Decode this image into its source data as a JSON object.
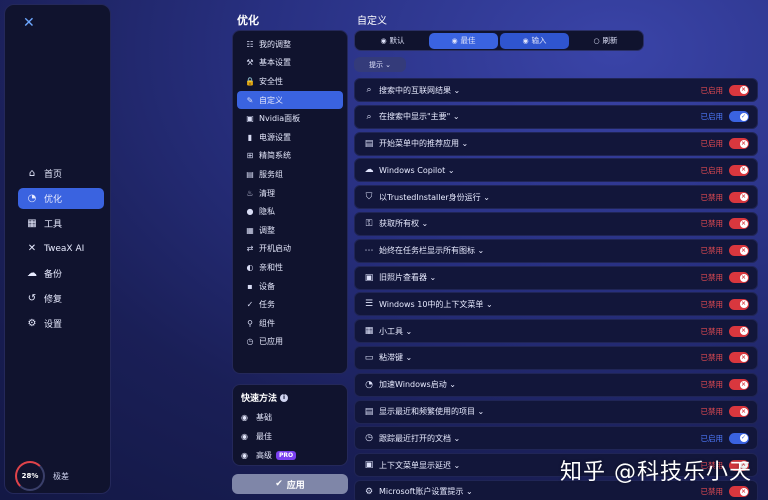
{
  "app": {
    "logo": "✕"
  },
  "sidebar": {
    "items": [
      {
        "label": "首页",
        "icon": "home-icon",
        "glyph": "⌂"
      },
      {
        "label": "优化",
        "icon": "gauge-icon",
        "glyph": "◔"
      },
      {
        "label": "工具",
        "icon": "grid-icon",
        "glyph": "▦"
      },
      {
        "label": "TweaX AI",
        "icon": "ai-icon",
        "glyph": "✕"
      },
      {
        "label": "备份",
        "icon": "cloud-icon",
        "glyph": "☁"
      },
      {
        "label": "修复",
        "icon": "history-icon",
        "glyph": "↺"
      },
      {
        "label": "设置",
        "icon": "gear-icon",
        "glyph": "⚙"
      }
    ],
    "score": "28%",
    "score_label": "极差"
  },
  "middle": {
    "title": "优化",
    "categories": [
      {
        "label": "我的调整",
        "glyph": "☷"
      },
      {
        "label": "基本设置",
        "glyph": "⚒"
      },
      {
        "label": "安全性",
        "glyph": "🔒"
      },
      {
        "label": "自定义",
        "glyph": "✎"
      },
      {
        "label": "Nvidia面板",
        "glyph": "▣"
      },
      {
        "label": "电源设置",
        "glyph": "▮"
      },
      {
        "label": "精简系统",
        "glyph": "⊞"
      },
      {
        "label": "服务组",
        "glyph": "▤"
      },
      {
        "label": "清理",
        "glyph": "♨"
      },
      {
        "label": "隐私",
        "glyph": "●"
      },
      {
        "label": "调整",
        "glyph": "▦"
      },
      {
        "label": "开机启动",
        "glyph": "⇄"
      },
      {
        "label": "亲和性",
        "glyph": "◐"
      },
      {
        "label": "设备",
        "glyph": "▪"
      },
      {
        "label": "任务",
        "glyph": "✓"
      },
      {
        "label": "组件",
        "glyph": "⚲"
      },
      {
        "label": "已应用",
        "glyph": "◷"
      }
    ],
    "quick_title": "快速方法",
    "quick_info": "i",
    "quick_items": [
      {
        "label": "基础",
        "glyph": "◉"
      },
      {
        "label": "最佳",
        "glyph": "◉"
      },
      {
        "label": "高级",
        "glyph": "◉"
      }
    ],
    "pro_badge": "PRO",
    "apply_icon": "✔",
    "apply_label": "应用"
  },
  "right": {
    "title": "自定义",
    "segments": [
      {
        "label": "默认",
        "glyph": "◉"
      },
      {
        "label": "最佳",
        "glyph": "◉"
      },
      {
        "label": "输入",
        "glyph": "◉"
      },
      {
        "label": "刷新",
        "glyph": "○"
      }
    ],
    "filter_label": "提示 ⌄",
    "rows": [
      {
        "label": "搜索中的互联网结果",
        "glyph": "⌕",
        "status": "已启用",
        "state": "off"
      },
      {
        "label": "在搜索中显示\"主要\"",
        "glyph": "⌕",
        "status": "已启用",
        "state": "on"
      },
      {
        "label": "开始菜单中的推荐应用",
        "glyph": "▤",
        "status": "已启用",
        "state": "off"
      },
      {
        "label": "Windows Copilot",
        "glyph": "☁",
        "status": "已启用",
        "state": "off"
      },
      {
        "label": "以TrustedInstaller身份运行",
        "glyph": "⛉",
        "status": "已禁用",
        "state": "off"
      },
      {
        "label": "获取所有权",
        "glyph": "⚿",
        "status": "已禁用",
        "state": "off"
      },
      {
        "label": "始终在任务栏显示所有图标",
        "glyph": "⋯",
        "status": "已禁用",
        "state": "off"
      },
      {
        "label": "旧照片查看器",
        "glyph": "▣",
        "status": "已禁用",
        "state": "off"
      },
      {
        "label": "Windows 10中的上下文菜单",
        "glyph": "☰",
        "status": "已禁用",
        "state": "off"
      },
      {
        "label": "小工具",
        "glyph": "▦",
        "status": "已禁用",
        "state": "off"
      },
      {
        "label": "粘滞键",
        "glyph": "▭",
        "status": "已禁用",
        "state": "off"
      },
      {
        "label": "加速Windows启动",
        "glyph": "◔",
        "status": "已禁用",
        "state": "off"
      },
      {
        "label": "显示最近和频繁使用的项目",
        "glyph": "▤",
        "status": "已禁用",
        "state": "off"
      },
      {
        "label": "跟踪最近打开的文档",
        "glyph": "◷",
        "status": "已启用",
        "state": "on"
      },
      {
        "label": "上下文菜单显示延迟",
        "glyph": "▣",
        "status": "已禁用",
        "state": "off"
      },
      {
        "label": "Microsoft账户设置提示",
        "glyph": "⚙",
        "status": "已禁用",
        "state": "off"
      }
    ]
  },
  "watermark": "知乎 @科技乐小天",
  "colors": {
    "accent": "#3a63e0",
    "danger": "#d9373e",
    "panel": "#10132e"
  }
}
